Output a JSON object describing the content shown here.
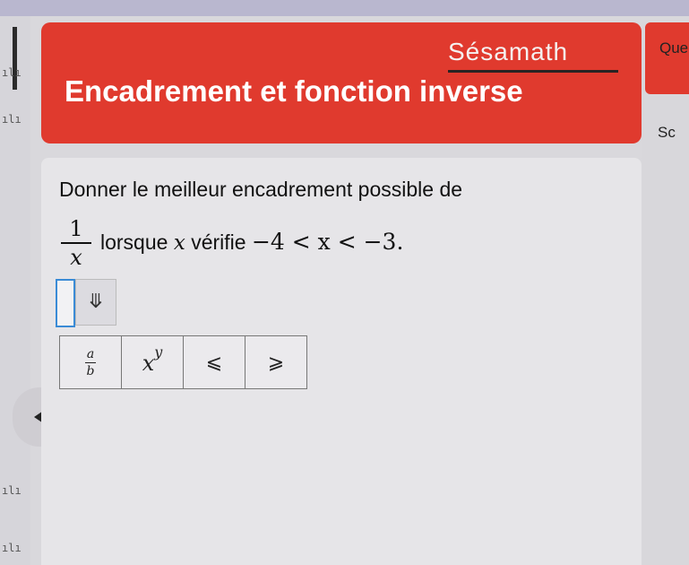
{
  "header": {
    "brand": "Sésamath",
    "title": "Encadrement et fonction inverse"
  },
  "right_panel": {
    "label_top": "Que",
    "label_bottom": "Sc"
  },
  "left_rail": {
    "marks": [
      "ılı",
      "ılı",
      "ılı",
      "ılı"
    ]
  },
  "exercise": {
    "instruction": "Donner le meilleur encadrement possible de",
    "fraction": {
      "numerator": "1",
      "denominator": "x"
    },
    "condition_prefix": "lorsque",
    "condition_var": "x",
    "condition_suffix": "vérifie",
    "condition_math": "−4 < x < −3."
  },
  "input": {
    "value": "",
    "dropdown_glyph": "⤋"
  },
  "keypad": {
    "frac_key": {
      "top": "a",
      "bottom": "b"
    },
    "power_key": {
      "base": "x",
      "exp": "y"
    },
    "leq_key": "⩽",
    "geq_key": "⩾"
  },
  "colors": {
    "header_bg": "#e03a2e",
    "input_border": "#3a8bd6"
  }
}
